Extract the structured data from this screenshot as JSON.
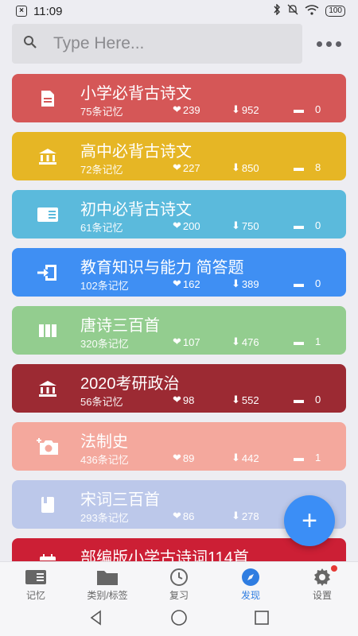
{
  "status": {
    "time": "11:09",
    "battery": "100"
  },
  "search": {
    "placeholder": "Type Here..."
  },
  "cards": [
    {
      "title": "小学必背古诗文",
      "count": "75条记忆",
      "likes": "239",
      "downloads": "952",
      "comments": "0",
      "color": "#d55757",
      "icon": "document-icon"
    },
    {
      "title": "高中必背古诗文",
      "count": "72条记忆",
      "likes": "227",
      "downloads": "850",
      "comments": "8",
      "color": "#e6b625",
      "icon": "bank-icon"
    },
    {
      "title": "初中必背古诗文",
      "count": "61条记忆",
      "likes": "200",
      "downloads": "750",
      "comments": "0",
      "color": "#5bbadc",
      "icon": "card-icon"
    },
    {
      "title": "教育知识与能力 简答题",
      "count": "102条记忆",
      "likes": "162",
      "downloads": "389",
      "comments": "0",
      "color": "#3f8ff3",
      "icon": "login-icon"
    },
    {
      "title": "唐诗三百首",
      "count": "320条记忆",
      "likes": "107",
      "downloads": "476",
      "comments": "1",
      "color": "#93cd8f",
      "icon": "columns-icon"
    },
    {
      "title": "2020考研政治",
      "count": "56条记忆",
      "likes": "98",
      "downloads": "552",
      "comments": "0",
      "color": "#9c2a33",
      "icon": "bank-icon"
    },
    {
      "title": "法制史",
      "count": "436条记忆",
      "likes": "89",
      "downloads": "442",
      "comments": "1",
      "color": "#f4a89d",
      "icon": "camera-add-icon"
    },
    {
      "title": "宋词三百首",
      "count": "293条记忆",
      "likes": "86",
      "downloads": "278",
      "comments": "",
      "color": "#bcc8ea",
      "icon": "book-icon"
    },
    {
      "title": "部编版小学古诗词114首",
      "count": "",
      "likes": "",
      "downloads": "",
      "comments": "",
      "color": "#cc1f35",
      "icon": "calendar-icon"
    }
  ],
  "fab": {
    "label": "+"
  },
  "nav": [
    {
      "label": "记忆",
      "icon": "memory-icon",
      "active": false
    },
    {
      "label": "类别/标签",
      "icon": "folder-icon",
      "active": false
    },
    {
      "label": "复习",
      "icon": "clock-icon",
      "active": false
    },
    {
      "label": "发现",
      "icon": "compass-icon",
      "active": true
    },
    {
      "label": "设置",
      "icon": "gear-icon",
      "active": false
    }
  ],
  "colors": {
    "accent": "#2f7de1",
    "background": "#ededf2"
  }
}
